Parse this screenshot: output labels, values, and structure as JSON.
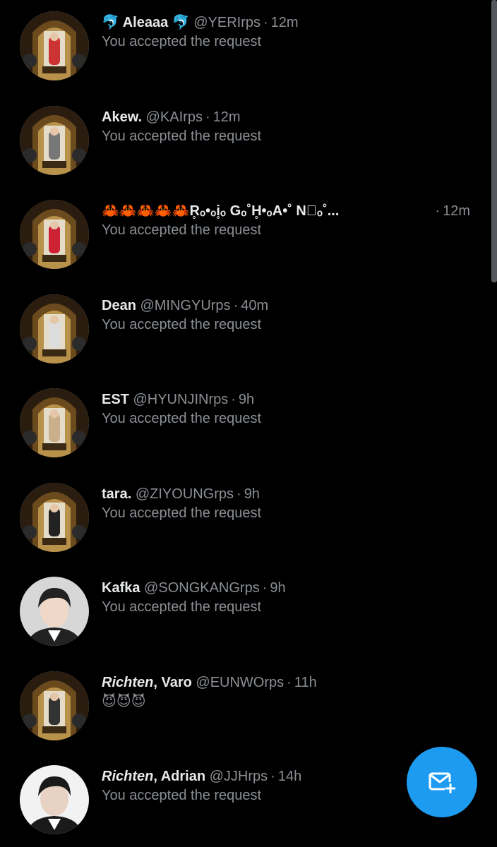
{
  "messages": [
    {
      "name": "🐬 Aleaaa 🐬",
      "handle": "@YERIrps",
      "time": "12m",
      "preview": "You accepted the request",
      "avatar_style": "frame",
      "avatar_colors": [
        "#6b4a1e",
        "#c33",
        "#2a1d10"
      ]
    },
    {
      "name": "Akew.",
      "handle": "@KAIrps",
      "time": "12m",
      "preview": "You accepted the request",
      "avatar_style": "frame",
      "avatar_colors": [
        "#6b4a1e",
        "#777",
        "#2a1d10"
      ]
    },
    {
      "name": "🦀🦀🦀🦀🦀R̥ₒ•ₒi̥ₒ Gₒ˚H̥•ₒA•˚ N᪶ₒ˚...",
      "time": "12m",
      "preview": "You accepted the request",
      "avatar_style": "frame",
      "avatar_colors": [
        "#6b4a1e",
        "#c23",
        "#2a1d10"
      ]
    },
    {
      "name": "Dean",
      "handle": "@MINGYUrps",
      "time": "40m",
      "preview": "You accepted the request",
      "avatar_style": "frame",
      "avatar_colors": [
        "#6b4a1e",
        "#ddd",
        "#2a1d10"
      ]
    },
    {
      "name": "EST",
      "handle": "@HYUNJINrps",
      "time": "9h",
      "preview": "You accepted the request",
      "avatar_style": "frame",
      "avatar_colors": [
        "#6b4a1e",
        "#c9b08a",
        "#2a1d10"
      ]
    },
    {
      "name": "tara.",
      "handle": "@ZIYOUNGrps",
      "time": "9h",
      "preview": "You accepted the request",
      "avatar_style": "frame",
      "avatar_colors": [
        "#6b4a1e",
        "#222",
        "#2a1d10"
      ]
    },
    {
      "name": "Kafka",
      "handle": "@SONGKANGrps",
      "time": "9h",
      "preview": "You accepted the request",
      "avatar_style": "portrait-light",
      "avatar_colors": [
        "#d7d7d7",
        "#222",
        "#f0d8c8"
      ]
    },
    {
      "name_italic": "Richten",
      "name_rest": ", Varo",
      "handle": "@EUNWOrps",
      "time": "11h",
      "preview": "😈😈😈",
      "avatar_style": "frame",
      "avatar_colors": [
        "#6b4a1e",
        "#333",
        "#2a1d10"
      ]
    },
    {
      "name_italic": "Richten",
      "name_rest": ", Adrian",
      "handle": "@JJHrps",
      "time": "14h",
      "preview": "You accepted the request",
      "avatar_style": "portrait-white",
      "avatar_colors": [
        "#f2f2f2",
        "#1a1a1a",
        "#e8d2c4"
      ]
    }
  ],
  "separator": "·",
  "fab": {
    "icon": "new-message-icon",
    "color": "#1d9bf0"
  },
  "colors": {
    "background": "#000000",
    "secondary_text": "#8b8f94",
    "accent": "#1d9bf0"
  }
}
